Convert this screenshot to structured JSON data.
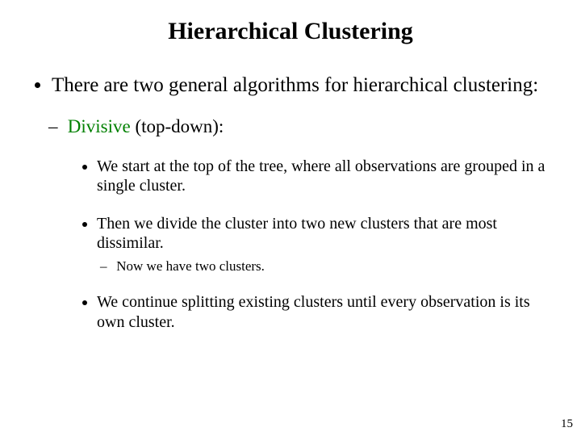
{
  "title": "Hierarchical Clustering",
  "intro": "There are two general algorithms for hierarchical clustering:",
  "sub1": {
    "name_colored": "Divisive",
    "name_suffix": " (top-down):"
  },
  "points": {
    "p1": "We start at the top of the tree, where all observations are grouped in a single cluster.",
    "p2": "Then we divide the cluster into two new clusters that are most dissimilar.",
    "p2_sub": "Now we have two clusters.",
    "p3": "We continue splitting existing clusters until every observation is its own cluster."
  },
  "page_number": "15"
}
